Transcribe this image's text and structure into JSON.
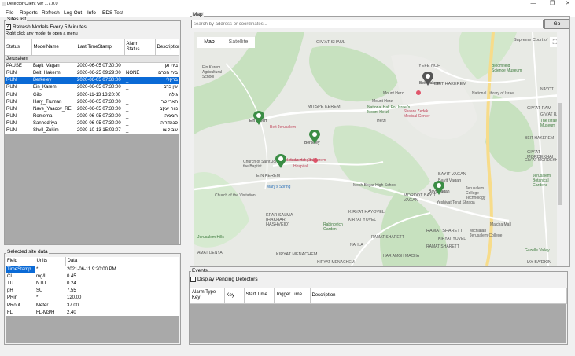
{
  "window": {
    "title": "Detector Client Ver 1.7.0.0",
    "minimize_glyph": "—",
    "maximize_glyph": "❐",
    "close_glyph": "✕"
  },
  "menu": [
    "File",
    "Reports",
    "Refresh",
    "Log Out",
    "Info",
    "EDS Test"
  ],
  "sites": {
    "group_label": "Sites list",
    "refresh_checkbox_label": "Refresh Models Every 5 Minutes",
    "refresh_checked": true,
    "hint": "Right click any model to open a menu",
    "columns": [
      "Status",
      "ModelName",
      "Last TimeStamp",
      "Alarm Status",
      "Description"
    ],
    "group_row": "Jerusalem",
    "rows": [
      {
        "status": "PAUSE",
        "model": "Bayit_Vagan",
        "ts": "2020-06-05 07:30:00",
        "alarm": "_",
        "desc": "בית וגן",
        "selected": false
      },
      {
        "status": "RUN",
        "model": "Beit_Hakerm",
        "ts": "2020-06-25 09:29:00",
        "alarm": "NONE",
        "desc": "בית הכרם",
        "selected": false
      },
      {
        "status": "RUN",
        "model": "Berkeley",
        "ts": "2020-06-05 07:30:00",
        "alarm": "_",
        "desc": "ברקלי",
        "selected": true
      },
      {
        "status": "RUN",
        "model": "Ein_Karem",
        "ts": "2020-06-05 07:30:00",
        "alarm": "_",
        "desc": "עין כרם",
        "selected": false
      },
      {
        "status": "RUN",
        "model": "Gilo",
        "ts": "2020-11-13 13:20:00",
        "alarm": "_",
        "desc": "גילה",
        "selected": false
      },
      {
        "status": "RUN",
        "model": "Hary_Truman",
        "ts": "2020-06-05 07:30:00",
        "alarm": "_",
        "desc": "הארי טר",
        "selected": false
      },
      {
        "status": "RUN",
        "model": "Nave_Yaacov_RE",
        "ts": "2020-06-05 07:30:00",
        "alarm": "_",
        "desc": "נווה יעקב",
        "selected": false
      },
      {
        "status": "RUN",
        "model": "Romema",
        "ts": "2020-06-05 07:30:00",
        "alarm": "_",
        "desc": "רוממה",
        "selected": false
      },
      {
        "status": "RUN",
        "model": "Sanhedriya",
        "ts": "2020-06-05 07:30:00",
        "alarm": "_",
        "desc": "סנהדריה",
        "selected": false
      },
      {
        "status": "RUN",
        "model": "Shvil_Zukim",
        "ts": "2020-10-13 15:02:07",
        "alarm": "_",
        "desc": "שביל צו",
        "selected": false
      }
    ]
  },
  "site_data": {
    "group_label": "Selected site data",
    "columns": [
      "Field",
      "Units",
      "Data"
    ],
    "rows": [
      {
        "field": "TimeStamp",
        "units": "*",
        "data": "2021-06-11 9:20:00 PM",
        "selected": true
      },
      {
        "field": "CL",
        "units": "mg/L",
        "data": "0.45",
        "selected": false
      },
      {
        "field": "TU",
        "units": "NTU",
        "data": "0.24",
        "selected": false
      },
      {
        "field": "pH",
        "units": "SU",
        "data": "7.55",
        "selected": false
      },
      {
        "field": "PRin",
        "units": "*",
        "data": "120.00",
        "selected": false
      },
      {
        "field": "PRout",
        "units": "Meter",
        "data": "37.00",
        "selected": false
      },
      {
        "field": "FL",
        "units": "FL-M3/H",
        "data": "2.40",
        "selected": false
      }
    ]
  },
  "map": {
    "group_label": "Map",
    "search_placeholder": "search by address or coordinates...",
    "go_label": "Go",
    "tabs": [
      "Map",
      "Satellite"
    ],
    "active_tab": "Map",
    "fullscreen_glyph": "⛶",
    "labels": [
      "GIV'AT SHAUL",
      "Supreme Court of",
      "YEFE NOF",
      "Bloomfield Science Museum",
      "Ein Kerem Agricultural School",
      "National Library of Israel",
      "BEIT HAKEREM",
      "MITSPE KEREM",
      "National Hall For Israel's Mount Herzl",
      "GIV'AT RAM",
      "Shaare Zedek Medical Center",
      "Ein Karem",
      "Berkeley",
      "Beit Jerusalem",
      "BAYIT VAGAN",
      "GIV'AT MORDEKHAI",
      "Church of Saint John the Baptist",
      "EIN KEREM",
      "Mary's Spring",
      "Hadassah Ein Kerem",
      "Jerusalem College Technology",
      "Mount Herzl",
      "Beit Hakerm",
      "Bayit Vagan",
      "Bayit Vagan",
      "MORDOT BAYIT VAGAN",
      "Hadassah Hospital",
      "KFAR SALMA (HAKHAR HASHVEID)",
      "KIRYAT HAYOVEL",
      "Rabinovich Garden",
      "RAMAT SHARETT",
      "Malcha Mall",
      "KIRYAT MENACHEM",
      "Gazelle Valley",
      "HAY BA'DKIN",
      "Church of the Visitation",
      "The Israel Museum",
      "Jerusalem Botanical Gardens",
      "Mosh Boyar High School",
      "Yeshivat Torat Shraga",
      "Michlalah Jerusalem College",
      "Jerusalem Hills",
      "AMAT DENYA",
      "KIRYAT YOVEL",
      "NAHLA",
      "HAR AMGH MACHA",
      "Hospital",
      "KIRYAT MENACHEM",
      "GIV'AT MORDEKHAI",
      "NAYOT",
      "BEIT HAKEREM",
      "KIRYAT YOVEL",
      "Mount Herzl",
      "Herzl",
      "GIV'AT RAM",
      "RAMAT SHARETT",
      "RAMAT SHARETT"
    ],
    "markers": [
      "Beit Hakerm",
      "Ein Karem",
      "Berkeley",
      "Ein Karem",
      "Bayit Vagan"
    ]
  },
  "events": {
    "group_label": "Events",
    "pending_checkbox_label": "Display Pending Detectors",
    "pending_checked": false,
    "columns": [
      "Alarm Type Key",
      "Key",
      "Start Time",
      "Trigger Time",
      "Description"
    ]
  },
  "colors": {
    "selection": "#0a6ad6",
    "panel_bg": "#f0f0f0",
    "grid_bg": "#a9a9a9",
    "marker": "#3b8d45",
    "map_bg": "#e8eae5",
    "park": "#c7e1bf",
    "road": "#f7dc8a"
  }
}
